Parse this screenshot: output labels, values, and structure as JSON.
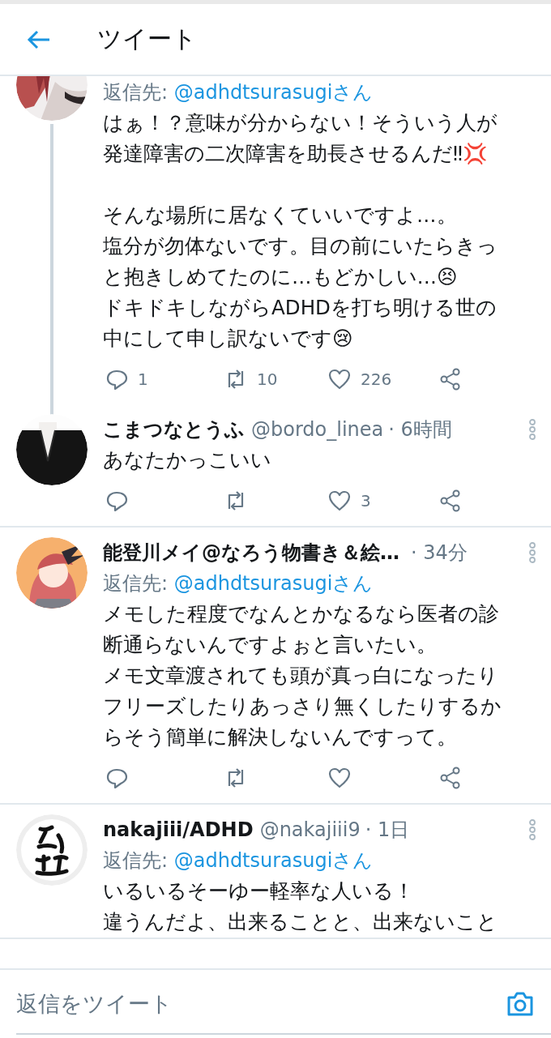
{
  "header": {
    "title": "ツイート"
  },
  "tweets": [
    {
      "partial": true,
      "thread_line": true,
      "avatar": {
        "kind": "picture"
      },
      "reply_to_label": "返信先:",
      "reply_to": "@adhdtsurasugiさん",
      "paragraphs": [
        [
          "はぁ！？意味が分からない！そういう人が",
          "発達障害の二次障害を助長させるんだ‼💢"
        ],
        [
          "そんな場所に居なくていいですよ…。",
          "塩分が勿体ないです。目の前にいたらきっ",
          "と抱きしめてたのに…もどかしい…😣",
          "ドキドキしながらADHDを打ち明ける世の",
          "中にして申し訳ないです😢"
        ]
      ],
      "actions": [
        {
          "kind": "reply",
          "count": "1"
        },
        {
          "kind": "retweet",
          "count": "10"
        },
        {
          "kind": "like",
          "count": "226"
        },
        {
          "kind": "share"
        }
      ]
    },
    {
      "partial": false,
      "thread_line": false,
      "avatar": {
        "kind": "picture"
      },
      "name": "こまつなとうふ",
      "handle": "@bordo_linea",
      "time": "· 6時間",
      "paragraphs": [
        [
          "あなたかっこいい"
        ]
      ],
      "actions": [
        {
          "kind": "reply"
        },
        {
          "kind": "retweet"
        },
        {
          "kind": "like",
          "count": "3"
        },
        {
          "kind": "share"
        }
      ]
    },
    {
      "partial": false,
      "thread_line": false,
      "avatar": {
        "kind": "picture"
      },
      "name": "能登川メイ@なろう物書き＆絵…",
      "time": "· 34分",
      "reply_to_label": "返信先:",
      "reply_to": "@adhdtsurasugiさん",
      "paragraphs": [
        [
          "メモした程度でなんとかなるなら医者の診",
          "断通らないんですよぉと言いたい。",
          "メモ文章渡されても頭が真っ白になったり",
          "フリーズしたりあっさり無くしたりするか",
          "らそう簡単に解決しないんですって。"
        ]
      ],
      "actions": [
        {
          "kind": "reply"
        },
        {
          "kind": "retweet"
        },
        {
          "kind": "like"
        },
        {
          "kind": "share"
        }
      ]
    },
    {
      "partial": false,
      "thread_line": false,
      "avatar": {
        "kind": "picture"
      },
      "name": "nakajiii/ADHD",
      "handle": "@nakajiii9",
      "time": "· 1日",
      "reply_to_label": "返信先:",
      "reply_to": "@adhdtsurasugiさん",
      "paragraphs": [
        [
          "いるいるそーゆー軽率な人いる！",
          "違うんだよ、出来ることと、出来ないこと"
        ]
      ]
    }
  ],
  "reply_bar": {
    "placeholder": "返信をツイート"
  }
}
